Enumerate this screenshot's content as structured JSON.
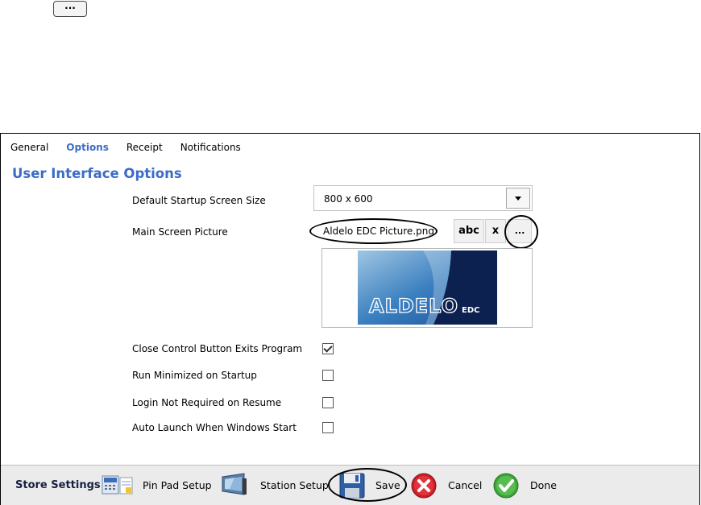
{
  "top_button": {
    "label": "..."
  },
  "tabs": [
    {
      "label": "General",
      "active": false
    },
    {
      "label": "Options",
      "active": true
    },
    {
      "label": "Receipt",
      "active": false
    },
    {
      "label": "Notifications",
      "active": false
    }
  ],
  "section": {
    "title": "User Interface Options"
  },
  "fields": {
    "startup_size": {
      "label": "Default Startup Screen Size",
      "value": "800 x 600"
    },
    "main_picture": {
      "label": "Main Screen Picture",
      "value": "Aldelo EDC Picture.png",
      "abc_label": "abc",
      "clear_label": "x",
      "browse_label": "..."
    }
  },
  "preview": {
    "logo_text": "ALDELO",
    "logo_suffix": "EDC"
  },
  "checkboxes": [
    {
      "label": "Close Control Button Exits Program",
      "checked": true
    },
    {
      "label": "Run Minimized on Startup",
      "checked": false
    },
    {
      "label": "Login Not Required on Resume",
      "checked": false
    },
    {
      "label": "Auto Launch When Windows Start",
      "checked": false
    }
  ],
  "footer": {
    "title": "Store Settings",
    "pin_pad": "Pin Pad Setup",
    "station": "Station Setup",
    "save": "Save",
    "cancel": "Cancel",
    "done": "Done"
  },
  "colors": {
    "accent": "#3b6cc7",
    "logo_bg": "#0d2150",
    "cancel": "#c8202b",
    "done": "#3fa33a"
  },
  "icons": [
    "pin-pad-icon",
    "station-icon",
    "save-icon",
    "cancel-icon",
    "done-icon"
  ]
}
